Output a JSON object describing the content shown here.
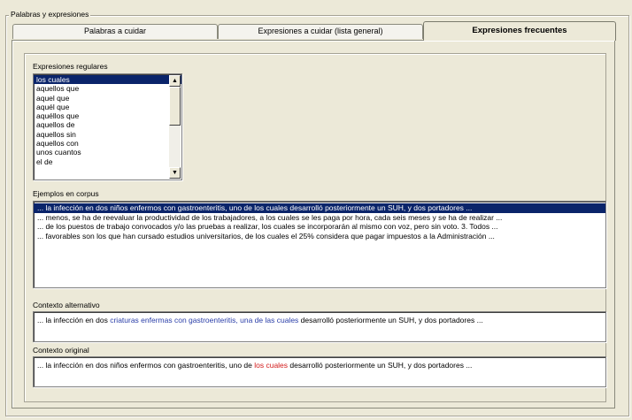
{
  "group_title": "Palabras y expresiones",
  "tabs": [
    {
      "label": "Palabras a cuidar",
      "active": false
    },
    {
      "label": "Expresiones a cuidar (lista general)",
      "active": false
    },
    {
      "label": "Expresiones frecuentes",
      "active": true
    }
  ],
  "regex_section": {
    "label": "Expresiones regulares",
    "items": [
      "los cuales",
      "aquellos que",
      "aquel que",
      "aquél que",
      "aquéllos que",
      "aquellos de",
      "aquellos sin",
      "aquellos con",
      "unos cuantos",
      "el de"
    ],
    "selected_index": 0
  },
  "corpus_section": {
    "label": "Ejemplos en corpus",
    "rows": [
      "... la infección en dos niños enfermos con gastroenteritis, uno de los cuales desarrolló posteriormente un SUH, y dos portadores ...",
      "... menos, se ha de reevaluar la productividad de los trabajadores, a los cuales se les paga por hora, cada seis meses y se ha de realizar ...",
      "... de los puestos de trabajo convocados y/o las pruebas a realizar, los cuales se incorporarán al mismo con voz, pero sin voto. 3. Todos ...",
      "... favorables son los que han cursado estudios universitarios, de los cuales el 25% considera que pagar impuestos a la Administración ..."
    ],
    "selected_index": 0
  },
  "alt_context": {
    "label": "Contexto alternativo",
    "before": "... la infección en dos ",
    "highlight": "criaturas enfermas con gastroenteritis, una de las cuales",
    "after": " desarrolló posteriormente un SUH, y dos portadores ...",
    "highlight_color": "#2a3ea8"
  },
  "orig_context": {
    "label": "Contexto original",
    "before": "... la infección en dos niños enfermos con gastroenteritis, uno de ",
    "highlight": "los cuales",
    "after": " desarrolló posteriormente un SUH, y dos portadores ...",
    "highlight_color": "#d21a1a"
  },
  "colors": {
    "window_bg": "#ece9d8",
    "selection_bg": "#0a246a"
  }
}
